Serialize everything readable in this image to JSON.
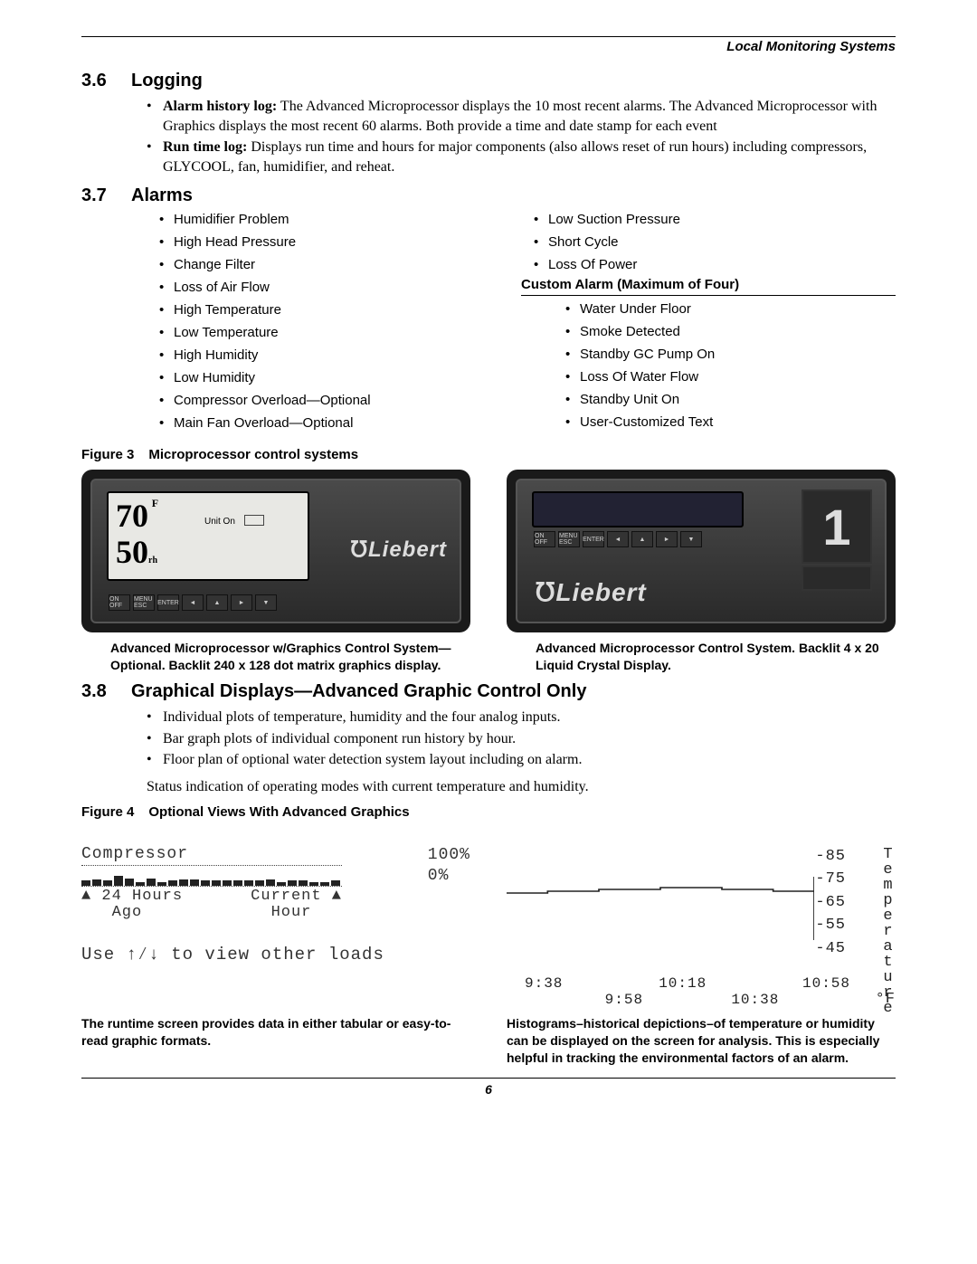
{
  "header": "Local Monitoring Systems",
  "page_number": "6",
  "s36": {
    "num": "3.6",
    "title": "Logging",
    "b1_lead": "Alarm history log:",
    "b1_text": " The Advanced Microprocessor displays the 10 most recent alarms. The Advanced Microprocessor with Graphics displays the most recent 60 alarms. Both provide a time and date stamp for each event",
    "b2_lead": "Run time log:",
    "b2_text": " Displays run time and hours for major components (also allows reset of run hours) including compressors, GLYCOOL, fan, humidifier, and reheat."
  },
  "s37": {
    "num": "3.7",
    "title": "Alarms",
    "left": [
      "Humidifier Problem",
      "High Head Pressure",
      "Change Filter",
      "Loss of Air Flow",
      "High Temperature",
      "Low Temperature",
      "High Humidity",
      "Low Humidity",
      "Compressor Overload—Optional",
      "Main Fan Overload—Optional"
    ],
    "right_top": [
      "Low Suction Pressure",
      "Short Cycle",
      "Loss Of Power"
    ],
    "custom_hdr": "Custom Alarm (Maximum of Four)",
    "right_custom": [
      "Water Under Floor",
      "Smoke Detected",
      "Standby GC Pump On",
      "Loss Of Water Flow",
      "Standby Unit On",
      "User-Customized Text"
    ]
  },
  "fig3": {
    "label": "Figure 3",
    "title": "Microprocessor control systems",
    "lcd_temp": "70",
    "lcd_temp_unit": "F",
    "lcd_hum": "50",
    "lcd_hum_unit": "rh",
    "lcd_status": "Unit On",
    "btn_on": "ON\nOFF",
    "btn_menu": "MENU\nESC",
    "btn_enter": "ENTER",
    "brand": "Liebert",
    "big_digit": "1",
    "cap_left": "Advanced Microprocessor w/Graphics Control System—Optional. Backlit 240 x 128 dot matrix graphics display.",
    "cap_right": "Advanced Microprocessor Control System. Backlit 4 x 20 Liquid Crystal Display."
  },
  "s38": {
    "num": "3.8",
    "title": "Graphical Displays—Advanced Graphic Control Only",
    "b1": "Individual plots of temperature, humidity and the four analog inputs.",
    "b2": "Bar graph plots of individual component run history by hour.",
    "b3": "Floor plan of optional water detection system layout including on alarm.",
    "status": "Status indication of operating modes with current temperature and humidity."
  },
  "fig4": {
    "label": "Figure 4",
    "title": "Optional Views With Advanced Graphics",
    "runtime_title": "Compressor",
    "pct100": "100%",
    "pct0": "0%",
    "ago1a": "24 Hours",
    "ago1b": "Ago",
    "cur1a": "Current",
    "cur1b": "Hour",
    "hint": "Use  ↑⁄↓  to view other loads",
    "cap_left": "The runtime screen provides data in either tabular or easy-to-read graphic formats.",
    "yvals": [
      "85",
      "75",
      "65",
      "55",
      "45"
    ],
    "vert_label": "Temperature",
    "unit": "°F",
    "xvals_top": [
      "9:38",
      "10:18",
      "10:58"
    ],
    "xvals_bot": [
      "9:58",
      "10:38"
    ],
    "cap_right": "Histograms–historical depictions–of temperature or humidity can be displayed on the screen for analysis. This is especially helpful in tracking the environmental factors of an alarm."
  },
  "chart_data": [
    {
      "type": "bar",
      "title": "Compressor",
      "xlabel": "24 Hours Ago → Current Hour",
      "ylabel": "%",
      "ylim": [
        0,
        100
      ],
      "values": [
        25,
        30,
        25,
        50,
        35,
        20,
        35,
        20,
        25,
        30,
        30,
        25,
        25,
        25,
        25,
        25,
        25,
        30,
        20,
        25,
        25,
        20,
        20,
        25
      ]
    },
    {
      "type": "line",
      "title": "Temperature",
      "ylabel": "Temperature °F",
      "ylim": [
        45,
        85
      ],
      "x": [
        "9:38",
        "9:58",
        "10:18",
        "10:38",
        "10:58"
      ],
      "y_estimated": [
        72,
        72,
        73,
        74,
        73
      ]
    }
  ]
}
